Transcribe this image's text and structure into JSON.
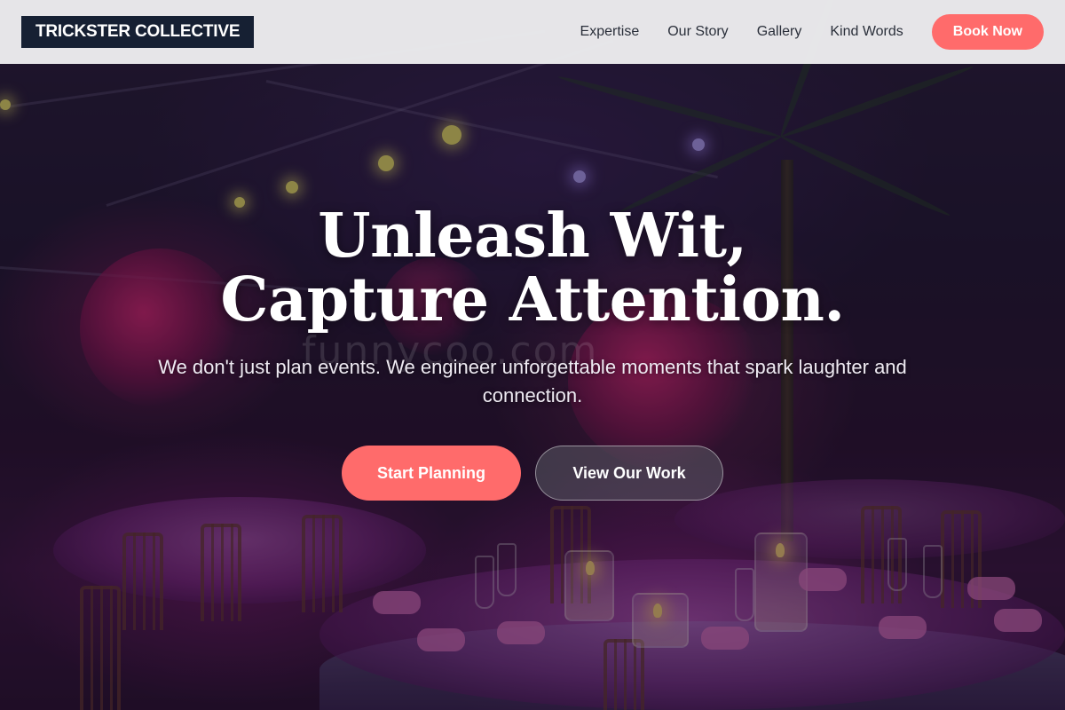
{
  "header": {
    "logo": "TRICKSTER COLLECTIVE",
    "nav": [
      "Expertise",
      "Our Story",
      "Gallery",
      "Kind Words"
    ],
    "cta": "Book Now"
  },
  "hero": {
    "title": "Unleash Wit, Capture Attention.",
    "subtitle": "We don't just plan events. We engineer unforgettable moments that spark laughter and connection.",
    "primary_button": "Start Planning",
    "secondary_button": "View Our Work",
    "watermark": "funnycoo.com"
  },
  "colors": {
    "accent": "#ff6b6b",
    "logo_bg": "#162033",
    "header_bg": "#ececee"
  }
}
